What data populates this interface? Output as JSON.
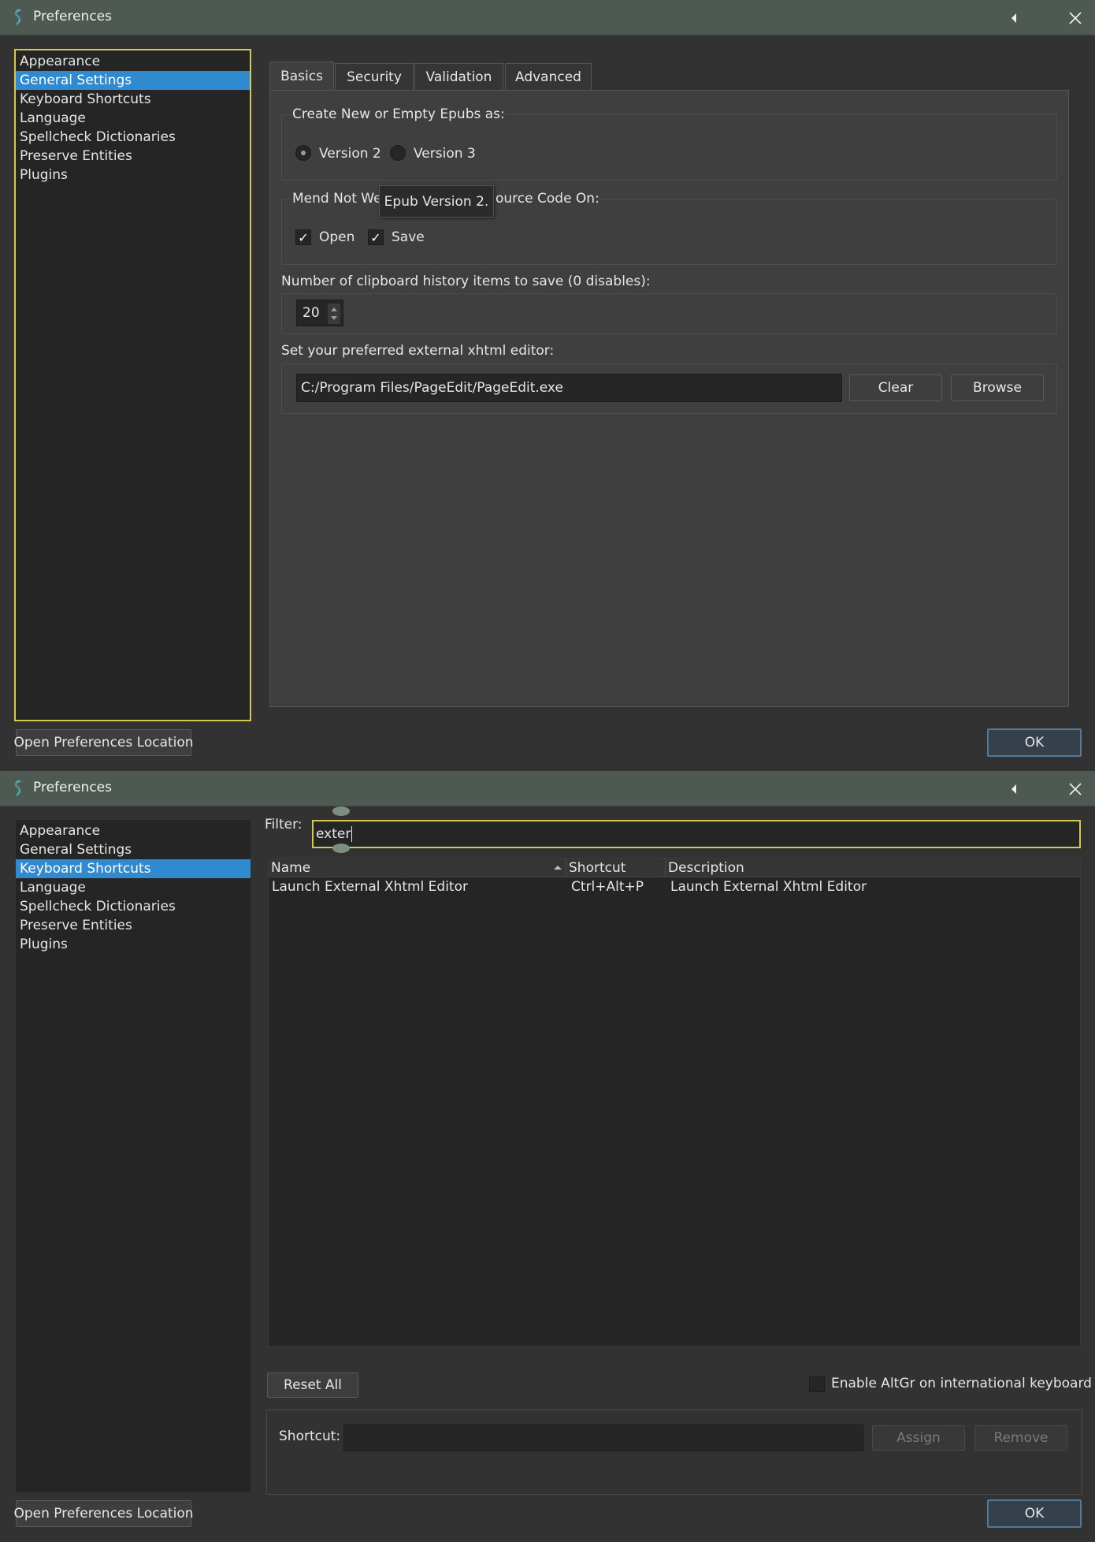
{
  "window_title": "Preferences",
  "sidebar": {
    "items": [
      {
        "label": "Appearance"
      },
      {
        "label": "General Settings"
      },
      {
        "label": "Keyboard Shortcuts"
      },
      {
        "label": "Language"
      },
      {
        "label": "Spellcheck Dictionaries"
      },
      {
        "label": "Preserve Entities"
      },
      {
        "label": "Plugins"
      }
    ]
  },
  "footer": {
    "open_location_label": "Open Preferences Location",
    "ok_label": "OK"
  },
  "general": {
    "selected_sidebar": "General Settings",
    "tabs": [
      {
        "label": "Basics",
        "active": true
      },
      {
        "label": "Security"
      },
      {
        "label": "Validation"
      },
      {
        "label": "Advanced"
      }
    ],
    "create_group": {
      "label": "Create New or Empty Epubs as:",
      "version2_label": "Version 2",
      "version3_label": "Version 3",
      "selected": "Version 2"
    },
    "mend_group": {
      "label_start": "Mend Not We",
      "label_end": "ource Code On:",
      "open_label": "Open",
      "open_checked": true,
      "save_label": "Save",
      "save_checked": true
    },
    "tooltip": "Epub Version 2.",
    "clipboard": {
      "label": "Number of clipboard history items to save (0 disables):",
      "value": "20"
    },
    "xhtml_editor": {
      "label": "Set your preferred external xhtml editor:",
      "path": "C:/Program Files/PageEdit/PageEdit.exe",
      "clear_label": "Clear",
      "browse_label": "Browse"
    }
  },
  "shortcuts": {
    "selected_sidebar": "Keyboard Shortcuts",
    "filter_label": "Filter:",
    "filter_value": "exter",
    "columns": {
      "name": "Name",
      "shortcut": "Shortcut",
      "description": "Description"
    },
    "rows": [
      {
        "name": "Launch External Xhtml Editor",
        "shortcut": "Ctrl+Alt+P",
        "description": "Launch External Xhtml Editor"
      }
    ],
    "reset_all_label": "Reset All",
    "altgr_label": "Enable AltGr on international keyboard",
    "shortcut_label": "Shortcut:",
    "shortcut_value": "",
    "assign_label": "Assign",
    "remove_label": "Remove"
  },
  "colors": {
    "titlebar": "#4e5a51",
    "selection": "#2f8ad0",
    "focus_border": "#d4c94a",
    "ok_border": "#4f7a9b"
  }
}
